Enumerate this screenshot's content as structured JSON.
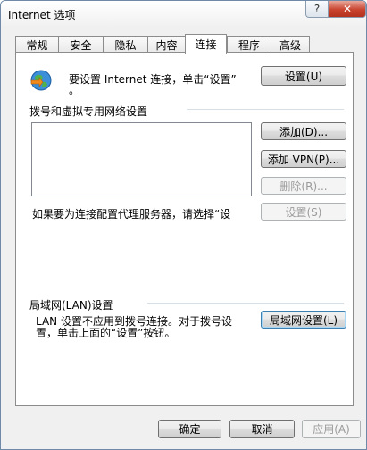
{
  "window": {
    "title": "Internet 选项"
  },
  "caption": {
    "help": "?",
    "close": "✕"
  },
  "tabs": [
    {
      "label": "常规",
      "active": false
    },
    {
      "label": "安全",
      "active": false
    },
    {
      "label": "隐私",
      "active": false
    },
    {
      "label": "内容",
      "active": false
    },
    {
      "label": "连接",
      "active": true
    },
    {
      "label": "程序",
      "active": false
    },
    {
      "label": "高级",
      "active": false
    }
  ],
  "setup": {
    "line1": "要设置 Internet 连接，单击“设置”",
    "line2": "。",
    "button": "设置(U)",
    "icon": "internet-globe-icon"
  },
  "dialup": {
    "heading": "拨号和虚拟专用网络设置",
    "add": "添加(D)...",
    "add_vpn": "添加 VPN(P)...",
    "delete": "删除(R)...",
    "proxy_text": "如果要为连接配置代理服务器，请选择“设",
    "settings": "设置(S)"
  },
  "lan": {
    "heading": "局域网(LAN)设置",
    "line1": "LAN 设置不应用到拨号连接。对于拨号设",
    "line2": "置，单击上面的“设置”按钮。",
    "button": "局域网设置(L)"
  },
  "footer": {
    "ok": "确定",
    "cancel": "取消",
    "apply": "应用(A)"
  }
}
